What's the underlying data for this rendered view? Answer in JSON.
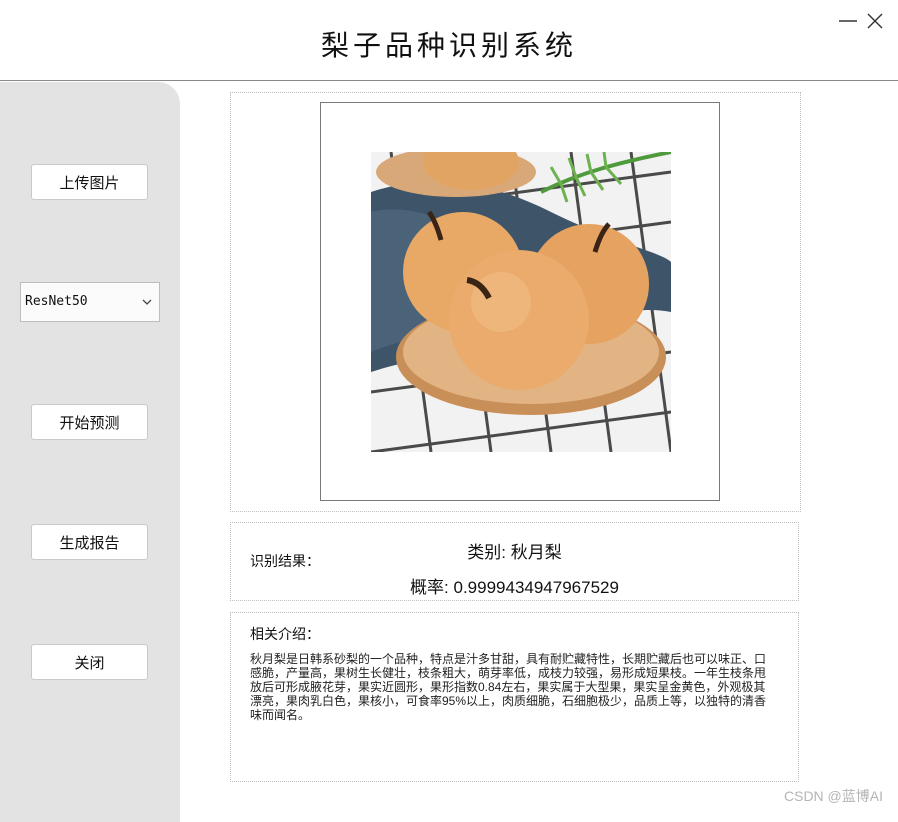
{
  "window": {
    "title": "梨子品种识别系统",
    "minimize_icon": "minimize-icon",
    "close_icon": "close-icon"
  },
  "sidebar": {
    "upload_label": "上传图片",
    "model_select": {
      "value": "ResNet50",
      "icon": "chevron-down-icon"
    },
    "predict_label": "开始预测",
    "report_label": "生成报告",
    "close_label": "关闭"
  },
  "result": {
    "label": "识别结果：",
    "class_text": "类别: 秋月梨",
    "prob_text": "概率: 0.9999434947967529"
  },
  "intro": {
    "title": "相关介绍：",
    "text": "秋月梨是日韩系砂梨的一个品种，特点是汁多甘甜，具有耐贮藏特性，长期贮藏后也可以味正、口感脆，产量高，果树生长健壮，枝条粗大，萌芽率低，成枝力较强，易形成短果枝。一年生枝条甩放后可形成腋花芽，果实近圆形，果形指数0.84左右，果实属于大型果，果实呈金黄色，外观极其漂亮，果肉乳白色，果核小，可食率95%以上，肉质细脆，石细胞极少，品质上等，以独特的清香味而闻名。"
  },
  "watermark": "CSDN @蓝博AI",
  "colors": {
    "sidebar_bg": "#e3e3e3",
    "pear": "#e8a866",
    "cloth": "#3e5569",
    "plate": "#d9a878"
  }
}
